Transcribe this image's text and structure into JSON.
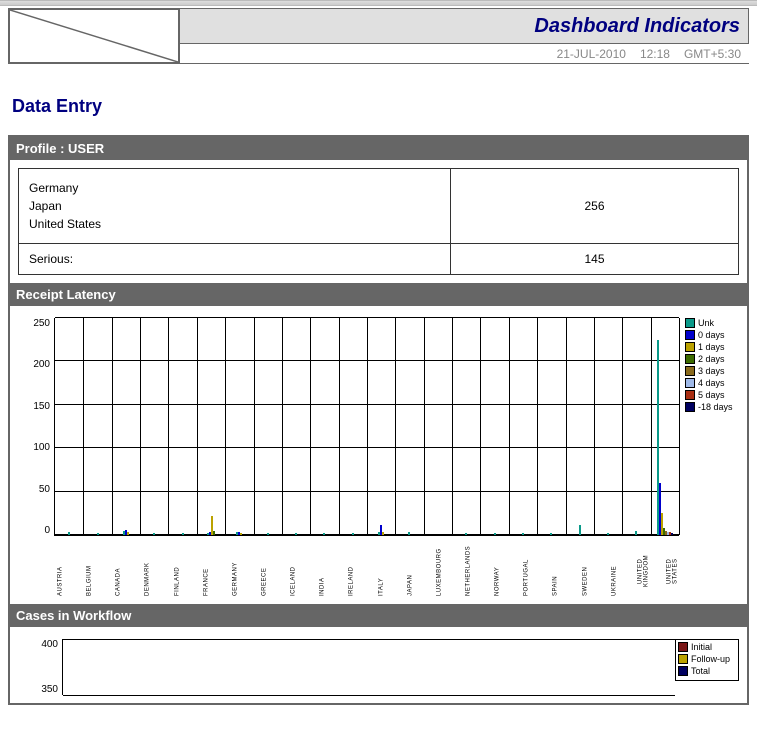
{
  "header": {
    "title": "Dashboard Indicators",
    "date": "21-JUL-2010",
    "time": "12:18",
    "tz": "GMT+5:30"
  },
  "section_title": "Data Entry",
  "profile": {
    "header": "Profile : USER",
    "countries": [
      "Germany",
      "Japan",
      "United States"
    ],
    "count": "256",
    "serious_label": "Serious:",
    "serious_value": "145"
  },
  "receipt": {
    "header": "Receipt Latency",
    "legend": [
      {
        "label": "Unk",
        "color": "#0b9a8a"
      },
      {
        "label": "0 days",
        "color": "#0000cc"
      },
      {
        "label": "1 days",
        "color": "#bba200"
      },
      {
        "label": "2 days",
        "color": "#3c6b00"
      },
      {
        "label": "3 days",
        "color": "#8a6a1c"
      },
      {
        "label": "4 days",
        "color": "#9fb9e8"
      },
      {
        "label": "5 days",
        "color": "#a82e12"
      },
      {
        "label": "-18 days",
        "color": "#000060"
      }
    ]
  },
  "workflow": {
    "header": "Cases in Workflow",
    "legend": [
      {
        "label": "Initial",
        "color": "#7a1616"
      },
      {
        "label": "Follow-up",
        "color": "#bba200"
      },
      {
        "label": "Total",
        "color": "#000060"
      }
    ]
  },
  "chart_data": [
    {
      "type": "bar",
      "title": "Receipt Latency",
      "ylabel": "",
      "ylim": [
        0,
        250
      ],
      "yticks": [
        0,
        50,
        100,
        150,
        200,
        250
      ],
      "categories": [
        "AUSTRIA",
        "BELGIUM",
        "CANADA",
        "DENMARK",
        "FINLAND",
        "FRANCE",
        "GERMANY",
        "GREECE",
        "ICELAND",
        "INDIA",
        "IRELAND",
        "ITALY",
        "JAPAN",
        "LUXEMBOURG",
        "NETHERLANDS",
        "NORWAY",
        "PORTUGAL",
        "SPAIN",
        "SWEDEN",
        "UKRAINE",
        "UNITED KINGDOM",
        "UNITED STATES"
      ],
      "series": [
        {
          "name": "Unk",
          "color": "#0b9a8a",
          "values": [
            3,
            2,
            5,
            2,
            2,
            2,
            3,
            2,
            2,
            2,
            2,
            3,
            3,
            0,
            2,
            2,
            2,
            2,
            12,
            2,
            5,
            225
          ]
        },
        {
          "name": "0 days",
          "color": "#0000cc",
          "values": [
            0,
            0,
            6,
            0,
            0,
            3,
            3,
            0,
            0,
            0,
            0,
            12,
            0,
            0,
            0,
            0,
            0,
            0,
            0,
            0,
            0,
            60
          ]
        },
        {
          "name": "1 days",
          "color": "#bba200",
          "values": [
            0,
            0,
            3,
            0,
            0,
            22,
            2,
            0,
            0,
            0,
            0,
            4,
            0,
            0,
            0,
            0,
            0,
            0,
            0,
            0,
            0,
            25
          ]
        },
        {
          "name": "2 days",
          "color": "#3c6b00",
          "values": [
            0,
            0,
            0,
            0,
            0,
            5,
            0,
            0,
            0,
            0,
            0,
            0,
            0,
            0,
            0,
            0,
            0,
            0,
            0,
            0,
            0,
            8
          ]
        },
        {
          "name": "3 days",
          "color": "#8a6a1c",
          "values": [
            0,
            0,
            0,
            0,
            0,
            0,
            0,
            0,
            0,
            0,
            0,
            0,
            0,
            0,
            0,
            0,
            0,
            0,
            0,
            0,
            0,
            5
          ]
        },
        {
          "name": "4 days",
          "color": "#9fb9e8",
          "values": [
            0,
            0,
            0,
            0,
            0,
            0,
            0,
            0,
            0,
            0,
            0,
            0,
            0,
            0,
            0,
            0,
            0,
            0,
            0,
            0,
            0,
            3
          ]
        },
        {
          "name": "5 days",
          "color": "#a82e12",
          "values": [
            0,
            0,
            0,
            0,
            0,
            0,
            0,
            0,
            0,
            0,
            0,
            0,
            0,
            0,
            0,
            0,
            0,
            0,
            0,
            0,
            0,
            3
          ]
        },
        {
          "name": "-18 days",
          "color": "#000060",
          "values": [
            0,
            0,
            0,
            0,
            0,
            0,
            0,
            0,
            0,
            0,
            0,
            0,
            0,
            0,
            0,
            0,
            0,
            0,
            0,
            0,
            0,
            2
          ]
        }
      ]
    },
    {
      "type": "bar",
      "title": "Cases in Workflow",
      "ylim": [
        0,
        400
      ],
      "yticks": [
        350,
        400
      ],
      "series": [
        {
          "name": "Initial",
          "color": "#7a1616"
        },
        {
          "name": "Follow-up",
          "color": "#bba200"
        },
        {
          "name": "Total",
          "color": "#000060"
        }
      ]
    }
  ]
}
